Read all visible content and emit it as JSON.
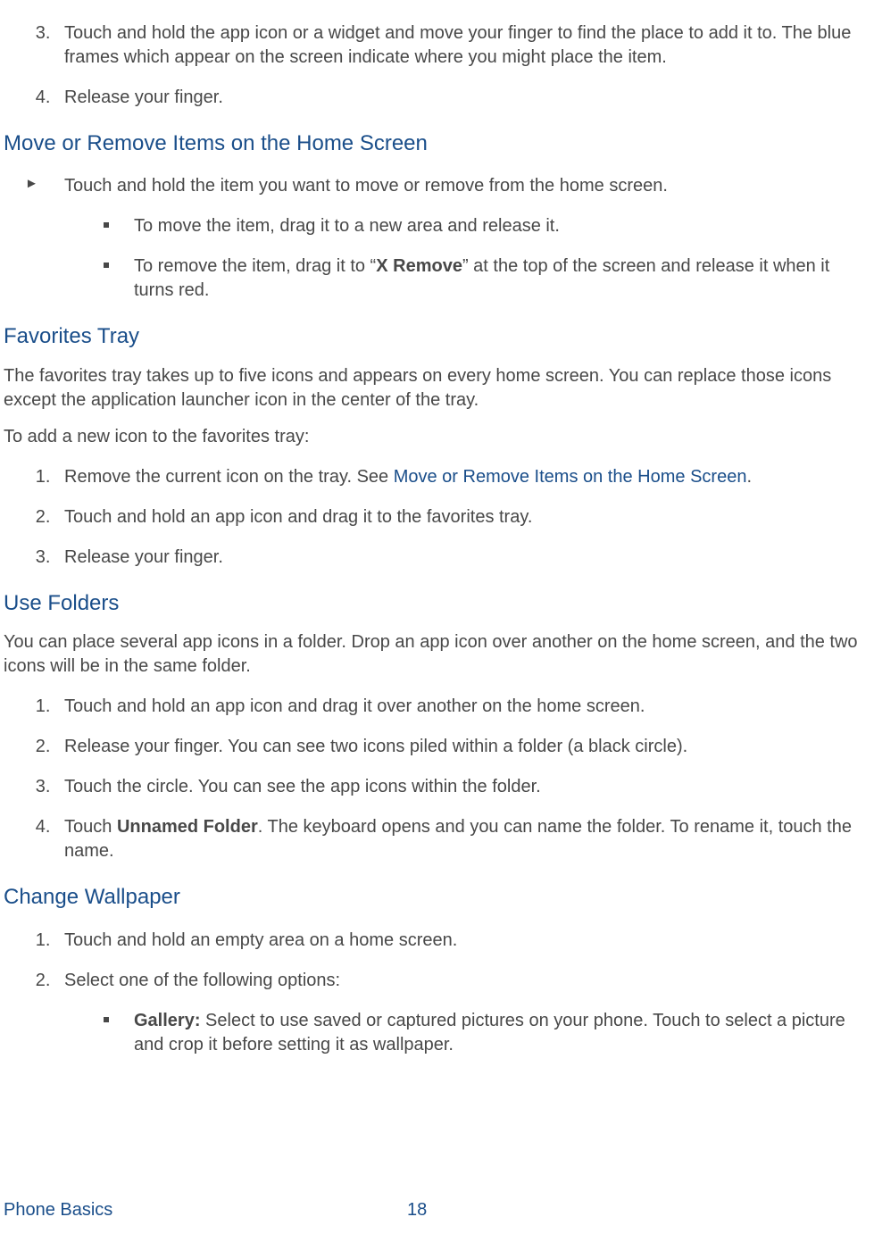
{
  "ol1": {
    "i3": "Touch and hold the app icon or a widget and move your finger to find the place to add it to. The blue frames which appear on the screen indicate where you might place the item.",
    "i4": "Release your finger.",
    "n3": "3.",
    "n4": "4."
  },
  "h1": "Move or Remove Items on the Home Screen",
  "arrow1": "Touch and hold the item you want to move or remove from the home screen.",
  "sq1a": "To move the item, drag it to a new area and release it.",
  "sq1b_1": "To remove the item, drag it to “",
  "sq1b_bold": "X Remove",
  "sq1b_2": "” at the top of the screen and release it when it turns red.",
  "h2": "Favorites Tray",
  "p2": "The favorites tray takes up to five icons and appears on every home screen. You can replace those icons except the application launcher icon in the center of the tray.",
  "p3": "To add a new icon to the favorites tray:",
  "ol2": {
    "i1a": "Remove the current icon on the tray. See ",
    "i1link": "Move or Remove Items on the Home Screen",
    "i1b": ".",
    "i2": "Touch and hold an app icon and drag it to the favorites tray.",
    "i3": "Release your finger."
  },
  "h3": "Use Folders",
  "p4": "You can place several app icons in a folder. Drop an app icon over another on the home screen, and the two icons will be in the same folder.",
  "ol3": {
    "i1": "Touch and hold an app icon and drag it over another on the home screen.",
    "i2": "Release your finger. You can see two icons piled within a folder (a black circle).",
    "i3": "Touch the circle. You can see the app icons within the folder.",
    "i4a": "Touch ",
    "i4bold": "Unnamed Folder",
    "i4b": ". The keyboard opens and you can name the folder. To rename it, touch the name."
  },
  "h4": "Change Wallpaper",
  "ol4": {
    "i1": "Touch and hold an empty area on a home screen.",
    "i2": "Select one of the following options:"
  },
  "sq4a_bold": "Gallery:",
  "sq4a": " Select to use saved or captured pictures on your phone. Touch to select a picture and crop it before setting it as wallpaper.",
  "footer": {
    "section": "Phone Basics",
    "page": "18"
  }
}
